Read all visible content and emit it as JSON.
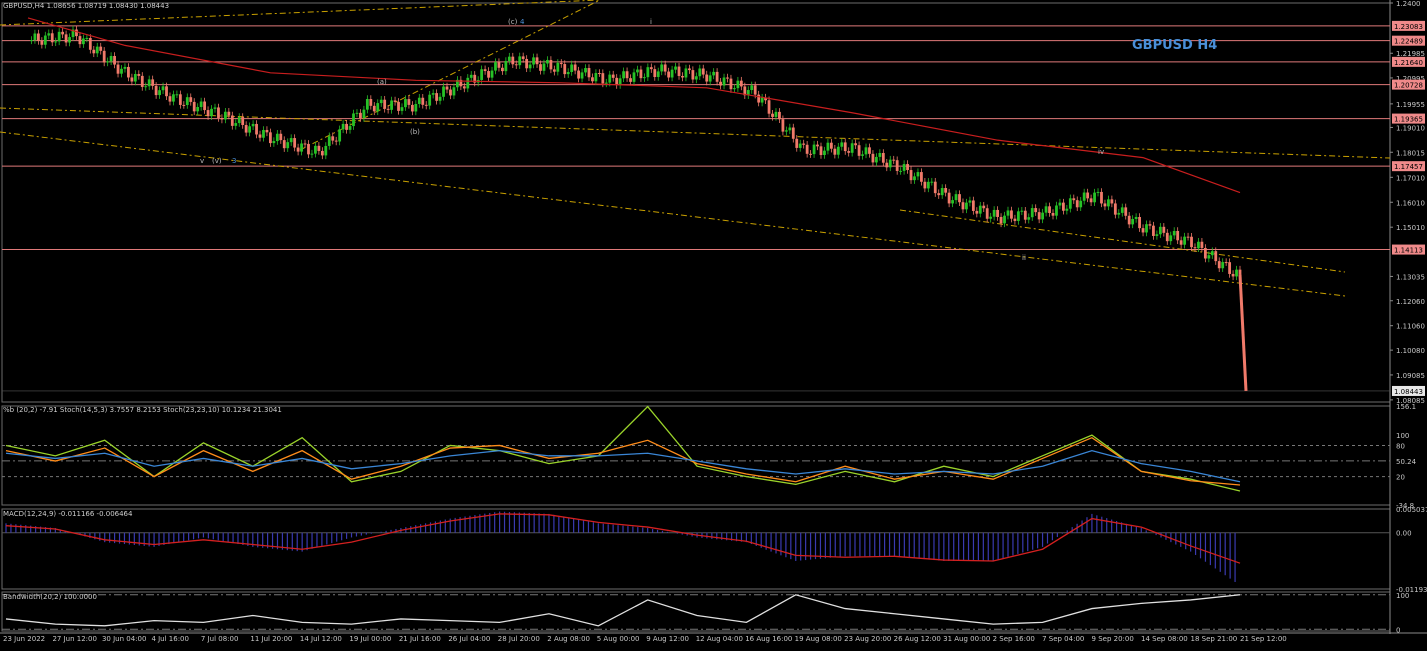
{
  "chart_data": [
    {
      "type": "candlestick",
      "panel": "price",
      "header": "GBPUSD,H4  1.08656 1.08719 1.08430 1.08443",
      "watermark": "GBPUSD H4",
      "symbol": "GBPUSD",
      "timeframe": "H4",
      "ylim": [
        1.08,
        1.24
      ],
      "grid": false,
      "y_ticks": [
        "1.2400",
        "1.21985",
        "1.20995",
        "1.19955",
        "1.19010",
        "1.18015",
        "1.17010",
        "1.16010",
        "1.15010",
        "1.13035",
        "1.12060",
        "1.11060",
        "1.10080",
        "1.09085",
        "1.08085"
      ],
      "x_labels": [
        "23 Jun 2022",
        "27 Jun 12:00",
        "30 Jun 04:00",
        "4 Jul 16:00",
        "7 Jul 08:00",
        "11 Jul 20:00",
        "14 Jul 12:00",
        "19 Jul 00:00",
        "21 Jul 16:00",
        "26 Jul 04:00",
        "28 Jul 20:00",
        "2 Aug 08:00",
        "5 Aug 00:00",
        "9 Aug 12:00",
        "12 Aug 04:00",
        "16 Aug 16:00",
        "19 Aug 08:00",
        "23 Aug 20:00",
        "26 Aug 12:00",
        "31 Aug 00:00",
        "2 Sep 16:00",
        "7 Sep 04:00",
        "9 Sep 20:00",
        "14 Sep 08:00",
        "18 Sep 21:00",
        "21 Sep 12:00"
      ],
      "horizontal_levels": [
        {
          "label": "1.23083",
          "value": 1.23083
        },
        {
          "label": "1.22489",
          "value": 1.22489
        },
        {
          "label": "1.21640",
          "value": 1.2164
        },
        {
          "label": "1.20728",
          "value": 1.20728
        },
        {
          "label": "1.19365",
          "value": 1.19365
        },
        {
          "label": "1.17457",
          "value": 1.17457
        },
        {
          "label": "1.14113",
          "value": 1.14113
        }
      ],
      "current_price": {
        "label": "1.08443",
        "value": 1.08443
      },
      "wave_labels": [
        "(a)",
        "(b)",
        "(c)",
        "4",
        "i",
        "ii",
        "iv",
        "v",
        "(v)",
        "3"
      ],
      "series": [
        {
          "name": "Close",
          "x": [
            "23 Jun 2022",
            "27 Jun 12:00",
            "30 Jun 04:00",
            "4 Jul 16:00",
            "7 Jul 08:00",
            "11 Jul 20:00",
            "14 Jul 12:00",
            "19 Jul 00:00",
            "21 Jul 16:00",
            "26 Jul 04:00",
            "28 Jul 20:00",
            "2 Aug 08:00",
            "5 Aug 00:00",
            "9 Aug 12:00",
            "12 Aug 04:00",
            "16 Aug 16:00",
            "19 Aug 08:00",
            "23 Aug 20:00",
            "26 Aug 12:00",
            "31 Aug 00:00",
            "2 Sep 16:00",
            "7 Sep 04:00",
            "9 Sep 20:00",
            "14 Sep 08:00",
            "18 Sep 21:00",
            "21 Sep 12:00"
          ],
          "values": [
            1.225,
            1.227,
            1.212,
            1.202,
            1.195,
            1.186,
            1.18,
            1.199,
            1.199,
            1.208,
            1.217,
            1.214,
            1.209,
            1.213,
            1.211,
            1.204,
            1.181,
            1.182,
            1.174,
            1.162,
            1.154,
            1.156,
            1.163,
            1.15,
            1.144,
            1.13
          ]
        },
        {
          "name": "Moving average (red)",
          "x": [
            "23 Jun 2022",
            "30 Jun 04:00",
            "11 Jul 20:00",
            "21 Jul 16:00",
            "2 Aug 08:00",
            "12 Aug 04:00",
            "23 Aug 20:00",
            "2 Sep 16:00",
            "14 Sep 08:00",
            "21 Sep 12:00"
          ],
          "values": [
            1.234,
            1.223,
            1.212,
            1.209,
            1.208,
            1.206,
            1.196,
            1.185,
            1.178,
            1.164
          ]
        }
      ]
    },
    {
      "type": "line",
      "panel": "oscillator",
      "header": "%b (20,2) -7.91  Stoch(14,5,3) 3.7557 8.2153  Stoch(23,23,10) 10.1234 21.3041",
      "ylim": [
        -34.8,
        156.1
      ],
      "y_ticks": [
        "156.1",
        "80",
        "100",
        "50.24",
        "20",
        "-34.8"
      ],
      "series": [
        {
          "name": "%b (20,2)",
          "color": "#9ad32a",
          "values": [
            80,
            60,
            90,
            20,
            85,
            40,
            95,
            10,
            30,
            80,
            70,
            45,
            60,
            155,
            40,
            20,
            5,
            30,
            10,
            40,
            20,
            60,
            100,
            30,
            15,
            -7.91
          ]
        },
        {
          "name": "Stoch(14,5,3)",
          "color": "#ff8c1a",
          "values": [
            70,
            50,
            75,
            20,
            70,
            30,
            70,
            15,
            40,
            75,
            80,
            55,
            65,
            90,
            45,
            25,
            10,
            40,
            15,
            30,
            15,
            55,
            95,
            30,
            12,
            3.7557
          ]
        },
        {
          "name": "Stoch(23,23,10)",
          "color": "#3a86d6",
          "values": [
            65,
            55,
            65,
            40,
            55,
            40,
            55,
            35,
            45,
            60,
            70,
            60,
            60,
            65,
            50,
            35,
            25,
            35,
            25,
            30,
            25,
            40,
            70,
            45,
            30,
            10.1234
          ]
        }
      ]
    },
    {
      "type": "bar",
      "panel": "macd",
      "header": "MACD(12,24,9) -0.011166 -0.006464",
      "ylim": [
        -0.011939,
        0.005037
      ],
      "y_ticks": [
        "0.005037",
        "0.00",
        "-0.011939"
      ],
      "series": [
        {
          "name": "MACD histogram",
          "color": "#3a3ab0",
          "values": [
            0.002,
            0.001,
            -0.002,
            -0.003,
            -0.001,
            -0.003,
            -0.004,
            -0.001,
            0.001,
            0.003,
            0.0045,
            0.004,
            0.002,
            0.001,
            -0.001,
            -0.002,
            -0.006,
            -0.005,
            -0.005,
            -0.006,
            -0.006,
            -0.003,
            0.004,
            0.001,
            -0.004,
            -0.011166
          ]
        },
        {
          "name": "Signal",
          "color": "#d42020",
          "values": [
            0.0015,
            0.0008,
            -0.0015,
            -0.0025,
            -0.0015,
            -0.0025,
            -0.0035,
            -0.002,
            0.0005,
            0.0025,
            0.004,
            0.0038,
            0.0022,
            0.0012,
            -0.0005,
            -0.0018,
            -0.0048,
            -0.0052,
            -0.005,
            -0.0058,
            -0.006,
            -0.0035,
            0.003,
            0.0012,
            -0.0028,
            -0.006464
          ]
        }
      ]
    },
    {
      "type": "line",
      "panel": "bandwidth",
      "header": "Bandwidth(20,2) 100.0000",
      "ylim": [
        -5,
        108
      ],
      "y_ticks": [
        "100",
        "0"
      ],
      "series": [
        {
          "name": "Bandwidth(20,2)",
          "color": "#e0e0e0",
          "values": [
            30,
            15,
            10,
            25,
            20,
            40,
            20,
            15,
            30,
            25,
            20,
            45,
            10,
            85,
            40,
            20,
            100,
            60,
            45,
            30,
            15,
            20,
            60,
            75,
            85,
            100
          ]
        }
      ]
    }
  ]
}
